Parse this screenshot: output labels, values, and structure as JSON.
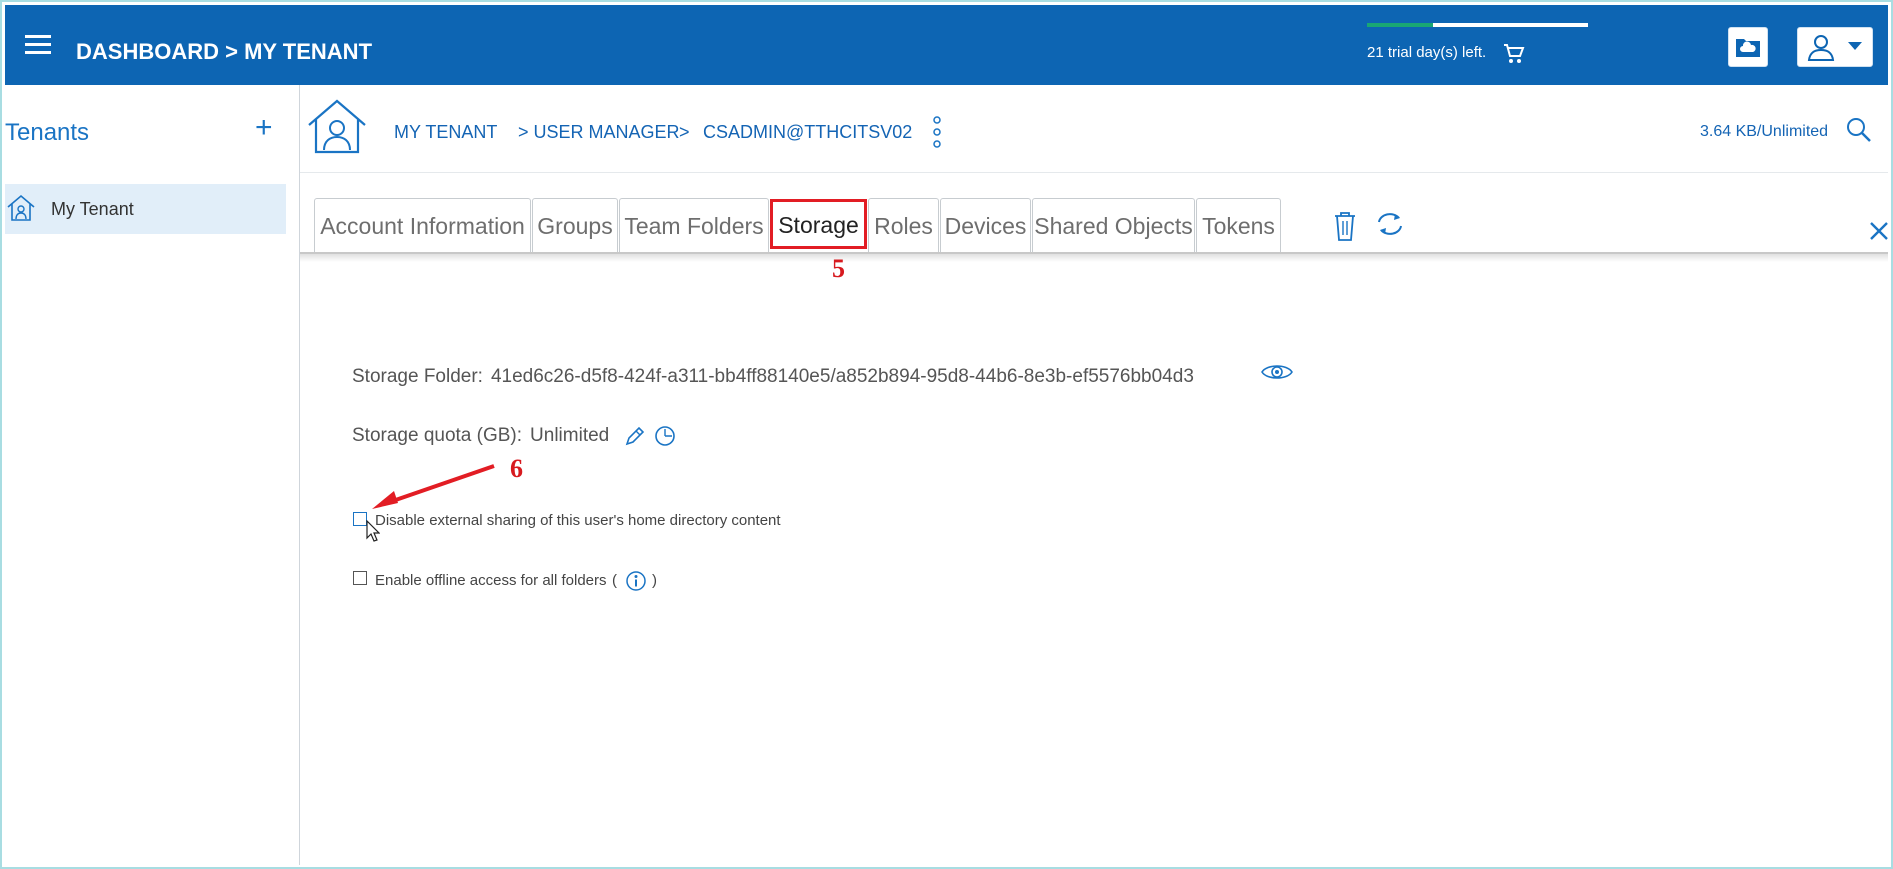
{
  "topbar": {
    "breadcrumb": "DASHBOARD > MY TENANT",
    "trial_text": "21 trial day(s) left.",
    "trial_progress": 0.3,
    "icons": [
      "menu-icon",
      "cart-icon",
      "cloud-folder-icon",
      "user-icon",
      "caret-down-icon"
    ]
  },
  "sidebar": {
    "title": "Tenants",
    "add_label": "+",
    "items": [
      {
        "label": "My Tenant",
        "icon": "home-icon"
      }
    ]
  },
  "header": {
    "crumbs": [
      "MY TENANT",
      "> USER MANAGER",
      ">",
      "CSADMIN@TTHCITSV02"
    ],
    "quota": "3.64 KB/Unlimited"
  },
  "tabs": [
    {
      "label": "Account Information"
    },
    {
      "label": "Groups"
    },
    {
      "label": "Team Folders"
    },
    {
      "label": "Storage",
      "active": true
    },
    {
      "label": "Roles"
    },
    {
      "label": "Devices"
    },
    {
      "label": "Shared Objects"
    },
    {
      "label": "Tokens"
    }
  ],
  "annotations": {
    "step5": "5",
    "step6": "6"
  },
  "storage": {
    "folder_label": "Storage Folder:",
    "folder_value": "41ed6c26-d5f8-424f-a311-bb4ff88140e5/a852b894-95d8-44b6-8e3b-ef5576bb04d3",
    "quota_label": "Storage quota (GB):",
    "quota_value": "Unlimited",
    "disable_sharing_label": "Disable external sharing of this user's home directory content",
    "disable_sharing_checked": false,
    "offline_label": "Enable offline access for all folders",
    "offline_checked": false,
    "paren_open": "(",
    "paren_close": ")"
  },
  "colors": {
    "topbar": "#0d65b3",
    "accent": "#1a74c4",
    "annotation": "#d71a1f",
    "trial_fill": "#19a774"
  }
}
